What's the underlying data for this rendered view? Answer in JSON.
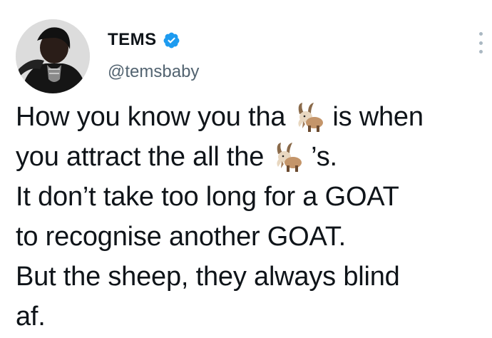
{
  "author": {
    "display_name": "TEMS",
    "handle": "@temsbaby",
    "verified": true,
    "verified_color": "#1d9bf0"
  },
  "icons": {
    "verified": "verified-badge-icon",
    "more": "more-options-icon",
    "emoji": "goat-emoji-icon"
  },
  "tweet": {
    "line1_a": "How you know you tha",
    "line1_b": "is when",
    "line2_a": "you attract the all the",
    "line2_b": "’s.",
    "line3": "It don’t take too long for a GOAT",
    "line4": "to recognise another GOAT.",
    "line5": "But the sheep, they always blind",
    "line6": "af."
  }
}
